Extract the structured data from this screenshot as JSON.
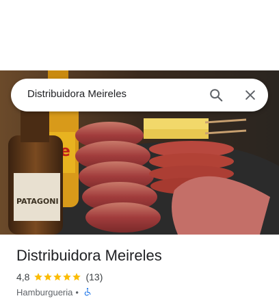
{
  "search": {
    "query": "Distribuidora Meireles",
    "search_icon": "search-icon",
    "close_icon": "close-icon"
  },
  "place": {
    "name": "Distribuidora Meireles",
    "rating": "4,8",
    "stars": 5,
    "review_count": "(13)",
    "category": "Hamburgueria",
    "separator": "•",
    "accessibility_icon": "wheelchair-accessible-icon"
  },
  "colors": {
    "star": "#fbbc04",
    "accessibility": "#1a73e8",
    "text_primary": "#202124",
    "text_secondary": "#5f6368"
  }
}
